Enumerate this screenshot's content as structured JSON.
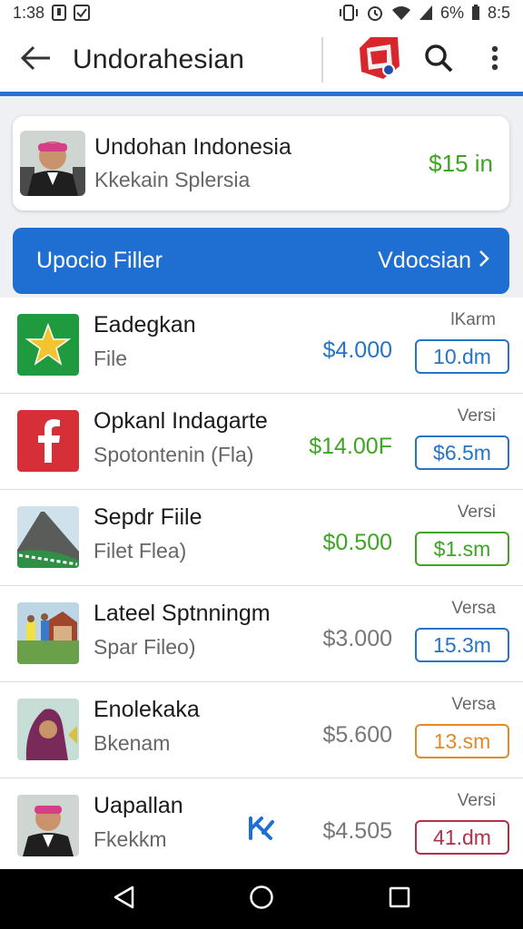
{
  "status_bar": {
    "time": "1:38",
    "battery": "6%",
    "clock_right": "8:5"
  },
  "app_bar": {
    "title": "Undorahesian",
    "icons": [
      "back-arrow-icon",
      "app-logo-icon",
      "search-icon",
      "more-vert-icon"
    ]
  },
  "profile": {
    "name": "Undohan Indonesia",
    "subtitle": "Kkekain Splersia",
    "price": "$15 in"
  },
  "filter": {
    "label": "Upocio Filler",
    "action": "Vdocsian"
  },
  "items": [
    {
      "title": "Eadegkan",
      "subtitle": "File",
      "price": "$4.000",
      "price_color": "#2574c6",
      "tag": "lKarm",
      "badge": "10.dm",
      "badge_color": "#2574c6"
    },
    {
      "title": "Opkanl Indagarte",
      "subtitle": "Spotontenin (Fla)",
      "price": "$14.00F",
      "price_color": "#3ea423",
      "tag": "Versi",
      "badge": "$6.5m",
      "badge_color": "#2574c6"
    },
    {
      "title": "Sepdr Fiile",
      "subtitle": "Filet Flea)",
      "price": "$0.500",
      "price_color": "#3ea423",
      "tag": "Versi",
      "badge": "$1.sm",
      "badge_color": "#3ea423"
    },
    {
      "title": "Lateel Sptnningm",
      "subtitle": "Spar Fileo)",
      "price": "$3.000",
      "price_color": "#777777",
      "tag": "Versa",
      "badge": "15.3m",
      "badge_color": "#2574c6"
    },
    {
      "title": "Enolekaka",
      "subtitle": "Bkenam",
      "price": "$5.600",
      "price_color": "#777777",
      "tag": "Versa",
      "badge": "13.sm",
      "badge_color": "#e08a2a"
    },
    {
      "title": "Uapallan",
      "subtitle": "Fkekkm",
      "price": "$4.505",
      "price_color": "#777777",
      "tag": "Versi",
      "badge": "41.dm",
      "badge_color": "#b0304a"
    }
  ],
  "nav": {
    "icons": [
      "back-triangle-icon",
      "home-circle-icon",
      "recents-square-icon"
    ]
  },
  "colors": {
    "accent": "#1f6fd2",
    "price_green": "#3ea423",
    "price_blue": "#2574c6"
  }
}
